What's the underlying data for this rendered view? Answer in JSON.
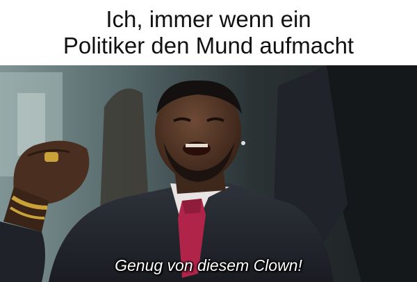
{
  "caption": {
    "lines": [
      "Ich, immer wenn ein",
      "Politiker den Mund aufmacht"
    ]
  },
  "photo": {
    "subtitle": "Genug von diesem Clown!",
    "colors": {
      "background": "#3a4a4c",
      "suit": "#23262e",
      "skin": "#5a3a2a",
      "shirt": "#e8e4e4",
      "tie": "#b0244a",
      "gold": "#c9a23a"
    }
  }
}
